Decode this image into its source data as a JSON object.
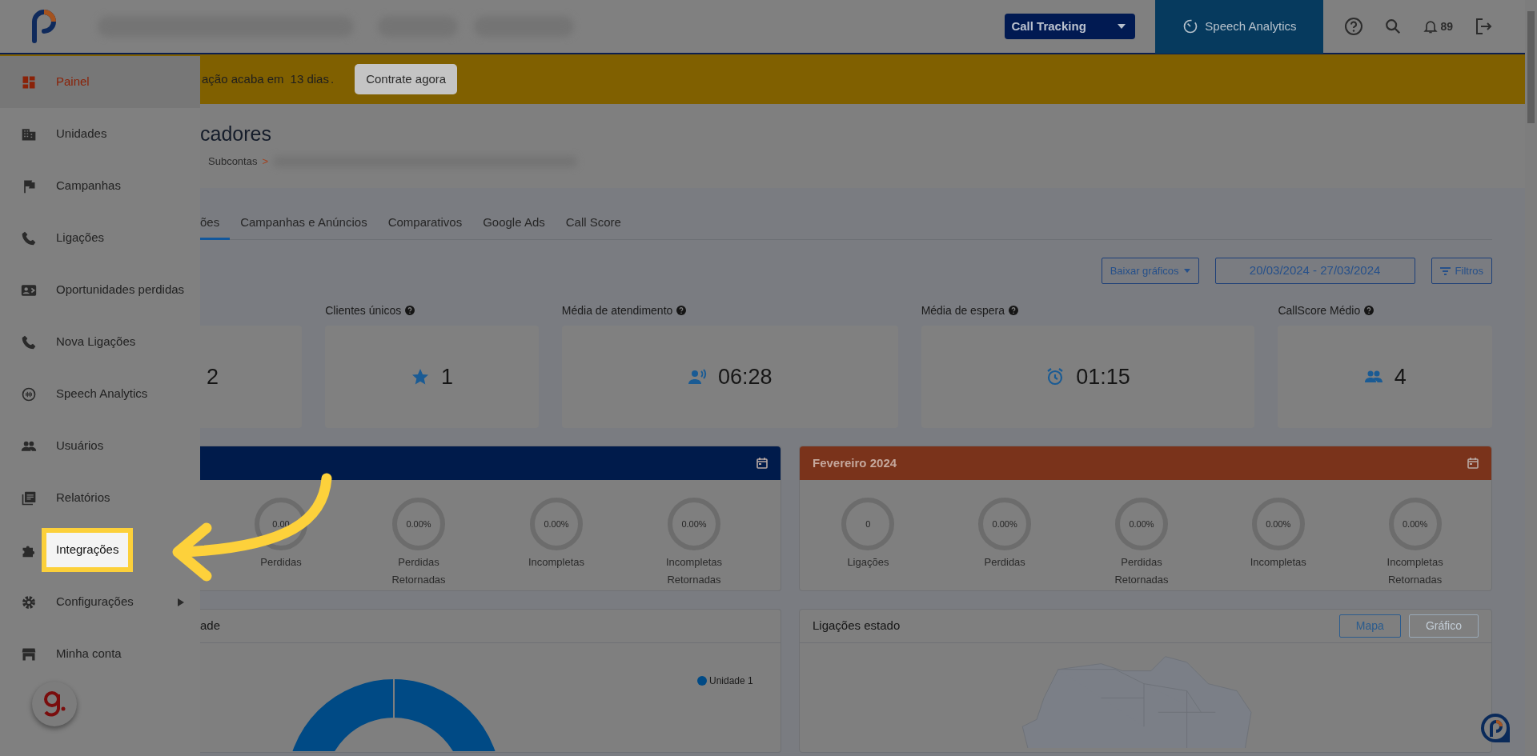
{
  "header": {
    "product_select": "Call Tracking",
    "module_link": "Speech Analytics",
    "notifications": "89"
  },
  "banner": {
    "text": "ação acaba em",
    "link": "13 dias ",
    "end": ".",
    "button": "Contrate agora"
  },
  "sidebar": {
    "items": [
      {
        "label": "Painel",
        "selected": true,
        "highlighted": false,
        "has_submenu": false
      },
      {
        "label": "Unidades",
        "selected": false,
        "highlighted": false,
        "has_submenu": false
      },
      {
        "label": "Campanhas",
        "selected": false,
        "highlighted": false,
        "has_submenu": false
      },
      {
        "label": "Ligações",
        "selected": false,
        "highlighted": false,
        "has_submenu": false
      },
      {
        "label": "Oportunidades perdidas",
        "selected": false,
        "highlighted": false,
        "has_submenu": false
      },
      {
        "label": "Nova Ligações",
        "selected": false,
        "highlighted": false,
        "has_submenu": false
      },
      {
        "label": "Speech Analytics",
        "selected": false,
        "highlighted": false,
        "has_submenu": false
      },
      {
        "label": "Usuários",
        "selected": false,
        "highlighted": false,
        "has_submenu": false
      },
      {
        "label": "Relatórios",
        "selected": false,
        "highlighted": false,
        "has_submenu": false
      },
      {
        "label": "Integrações",
        "selected": false,
        "highlighted": true,
        "has_submenu": false
      },
      {
        "label": "Configurações",
        "selected": false,
        "highlighted": false,
        "has_submenu": true
      },
      {
        "label": "Minha conta",
        "selected": false,
        "highlighted": false,
        "has_submenu": false
      }
    ]
  },
  "page": {
    "title": "cadores",
    "breadcrumb": "Subcontas",
    "separator": ">"
  },
  "tabs": [
    {
      "label": "ões",
      "selected": true
    },
    {
      "label": "Campanhas e Anúncios",
      "selected": false
    },
    {
      "label": "Comparativos",
      "selected": false
    },
    {
      "label": "Google Ads",
      "selected": false
    },
    {
      "label": "Call Score",
      "selected": false
    }
  ],
  "toolbar": {
    "download": "Baixar gráficos",
    "date_range": "20/03/2024 - 27/03/2024",
    "filters": "Filtros"
  },
  "kpis": [
    {
      "value": "2"
    },
    {
      "label": "Clientes únicos",
      "value": "1"
    },
    {
      "label": "Média de atendimento",
      "value": "06:28"
    },
    {
      "label": "Média de espera",
      "value": "01:15"
    },
    {
      "label": "CallScore Médio",
      "value": "4"
    }
  ],
  "month_cards": [
    {
      "color": "#001b4b",
      "stats": [
        {
          "value": "0.00",
          "label": "Perdidas"
        },
        {
          "value": "0.00%",
          "label": "Perdidas Retornadas"
        },
        {
          "value": "0.00%",
          "label": "Incompletas"
        },
        {
          "value": "0.00%",
          "label": "Incompletas Retornadas"
        }
      ]
    },
    {
      "title": "Fevereiro 2024",
      "color": "#7a331b",
      "stats": [
        {
          "value": "0",
          "label": "Ligações"
        },
        {
          "value": "0.00%",
          "label": "Perdidas"
        },
        {
          "value": "0.00%",
          "label": "Perdidas Retornadas"
        },
        {
          "value": "0.00%",
          "label": "Incompletas"
        },
        {
          "value": "0.00%",
          "label": "Incompletas Retornadas"
        }
      ]
    }
  ],
  "units_card": {
    "title": "ade",
    "legend": [
      {
        "label": "Unidade 1",
        "color": "#004a85"
      }
    ]
  },
  "states_card": {
    "title": "Ligações estado",
    "buttons": [
      {
        "label": "Mapa",
        "selected": true
      },
      {
        "label": "Gráfico",
        "selected": false
      }
    ]
  }
}
